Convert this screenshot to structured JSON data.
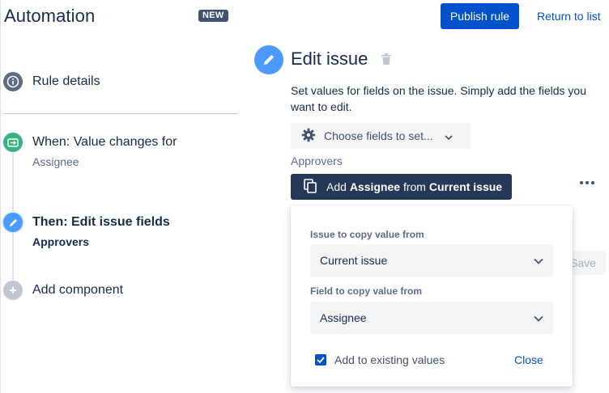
{
  "header": {
    "app_title": "Automation",
    "badge": "NEW",
    "publish_label": "Publish rule",
    "return_label": "Return to list"
  },
  "sidebar": {
    "rule_details": "Rule details",
    "when_title": "When: Value changes for",
    "when_sub": "Assignee",
    "then_title": "Then: Edit issue fields",
    "then_sub": "Approvers",
    "add_component": "Add component"
  },
  "panel": {
    "title": "Edit issue",
    "description": "Set values for fields on the issue. Simply add the fields you want to edit.",
    "choose_fields": "Choose fields to set...",
    "field_label": "Approvers",
    "add_prefix": "Add ",
    "add_field": "Assignee",
    "add_mid": " from ",
    "add_source": "Current issue",
    "save_label": "Save"
  },
  "popup": {
    "issue_label": "Issue to copy value from",
    "issue_value": "Current issue",
    "field_label": "Field to copy value from",
    "field_value": "Assignee",
    "checkbox_label": "Add to existing values",
    "checkbox_checked": true,
    "close_label": "Close"
  },
  "colors": {
    "primary": "#0052cc",
    "dark_button": "#253858",
    "edit_accent": "#4c9aff",
    "trigger_green": "#36b37e",
    "info_grey": "#5e6c84"
  },
  "icons": [
    "info-icon",
    "trigger-icon",
    "pencil-icon",
    "plus-icon",
    "trash-icon",
    "gear-icon",
    "chevron-down-icon",
    "copy-icon",
    "more-icon",
    "check-icon"
  ]
}
